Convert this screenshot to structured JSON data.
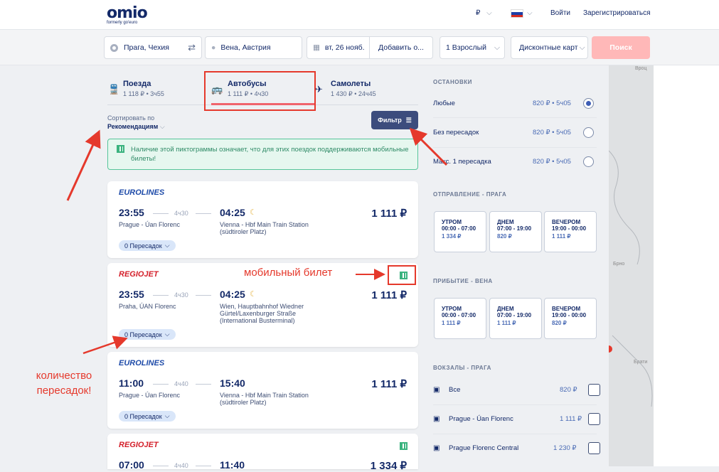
{
  "header": {
    "logo": "omio",
    "logo_sub": "formerly go'euro",
    "currency": "₽",
    "currency_chevron": "⌵",
    "lang_chevron": "⌵",
    "login": "Войти",
    "register": "Зарегистрироваться",
    "flag_colors": [
      "#ffffff",
      "#1c3fa8",
      "#d52b1e"
    ]
  },
  "search": {
    "from": "Прага, Чехия",
    "to": "Вена, Австрия",
    "date": "вт, 26 нояб.",
    "add_return": "Добавить о...",
    "passengers": "1 Взрослый",
    "discount": "Дисконтные карт",
    "button": "Поиск"
  },
  "tabs": [
    {
      "label": "Поезда",
      "sub": "1 118 ₽ • 3ч55",
      "icon": "train-icon"
    },
    {
      "label": "Автобусы",
      "sub": "1 111 ₽ • 4ч30",
      "icon": "bus-icon"
    },
    {
      "label": "Самолеты",
      "sub": "1 430 ₽ • 24ч45",
      "icon": "plane-icon"
    }
  ],
  "sort": {
    "label": "Сортировать по",
    "value": "Рекомендациям"
  },
  "filter_button": "Фильтр",
  "info_banner": "Наличие этой пиктограммы означает, что для этих поездок поддерживаются мобильные билеты!",
  "results": [
    {
      "brand": "EUROLINES",
      "dep": "23:55",
      "dur": "4ч30",
      "arr": "04:25",
      "from": "Prague - Úan Florenc",
      "to": "Vienna - Hbf Main Train Station (südtiroler Platz)",
      "price": "1 111 ₽",
      "transfers": "0 Пересадок",
      "mobile": false
    },
    {
      "brand": "REGIOJET",
      "dep": "23:55",
      "dur": "4ч30",
      "arr": "04:25",
      "from": "Praha, ÚAN Florenc",
      "to": "Wien, Hauptbahnhof Wiedner Gürtel/Laxenburger Straße (International Busterminal)",
      "price": "1 111 ₽",
      "transfers": "0 Пересадок",
      "mobile": true
    },
    {
      "brand": "EUROLINES",
      "dep": "11:00",
      "dur": "4ч40",
      "arr": "15:40",
      "from": "Prague - Úan Florenc",
      "to": "Vienna - Hbf Main Train Station (südtiroler Platz)",
      "price": "1 111 ₽",
      "transfers": "0 Пересадок",
      "mobile": false
    },
    {
      "brand": "REGIOJET",
      "dep": "07:00",
      "dur": "4ч40",
      "arr": "11:40",
      "price": "1 334 ₽",
      "mobile": true
    }
  ],
  "filters": {
    "stops_title": "ОСТАНОВКИ",
    "stops": [
      {
        "label": "Любые",
        "price": "820 ₽ • 5ч05",
        "selected": true
      },
      {
        "label": "Без пересадок",
        "price": "820 ₽ • 5ч05",
        "selected": false
      },
      {
        "label": "Макс. 1 пересадка",
        "price": "820 ₽ • 5ч05",
        "selected": false
      }
    ],
    "departure_title": "ОТПРАВЛЕНИЕ - ПРАГА",
    "departure": [
      {
        "label": "УТРОМ",
        "time": "00:00 - 07:00",
        "price": "1 334 ₽"
      },
      {
        "label": "ДНЕМ",
        "time": "07:00 - 19:00",
        "price": "820 ₽"
      },
      {
        "label": "ВЕЧЕРОМ",
        "time": "19:00 - 00:00",
        "price": "1 111 ₽"
      }
    ],
    "arrival_title": "ПРИБЫТИЕ - ВЕНА",
    "arrival": [
      {
        "label": "УТРОМ",
        "time": "00:00 - 07:00",
        "price": "1 111 ₽"
      },
      {
        "label": "ДНЕМ",
        "time": "07:00 - 19:00",
        "price": "1 111 ₽"
      },
      {
        "label": "ВЕЧЕРОМ",
        "time": "19:00 - 00:00",
        "price": "820 ₽"
      }
    ],
    "stations_title": "ВОКЗАЛЫ - ПРАГА",
    "stations": [
      {
        "label": "Все",
        "price": "820 ₽"
      },
      {
        "label": "Prague - Úan Florenc",
        "price": "1 111 ₽"
      },
      {
        "label": "Prague Florenc Central",
        "price": "1 230 ₽"
      }
    ]
  },
  "map_labels": [
    "Вроц",
    "Брно",
    "Брати"
  ],
  "annotations": {
    "mobile_ticket": "мобильный билет",
    "transfers_count": "количество пересадок!"
  }
}
